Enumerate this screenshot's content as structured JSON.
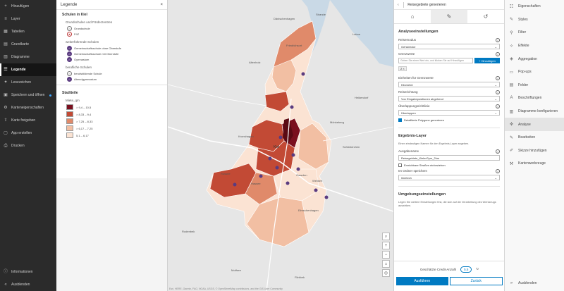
{
  "leftnav": {
    "items": [
      {
        "label": "Hinzufügen",
        "icon": "plus-icon"
      },
      {
        "label": "Layer",
        "icon": "layers-icon"
      },
      {
        "label": "Tabellen",
        "icon": "table-icon"
      },
      {
        "label": "Grundkarte",
        "icon": "basemap-icon"
      },
      {
        "label": "Diagramme",
        "icon": "chart-icon"
      },
      {
        "label": "Legende",
        "icon": "legend-icon"
      },
      {
        "label": "Lesezeichen",
        "icon": "bookmark-icon"
      },
      {
        "label": "Speichern und öffnen",
        "icon": "save-icon"
      },
      {
        "label": "Karteneigenschaften",
        "icon": "map-properties-icon"
      },
      {
        "label": "Karte freigeben",
        "icon": "share-icon"
      },
      {
        "label": "App erstellen",
        "icon": "app-icon"
      },
      {
        "label": "Drucken",
        "icon": "print-icon"
      }
    ],
    "bottom": [
      {
        "label": "Informationen",
        "icon": "info-icon"
      },
      {
        "label": "Ausblenden",
        "icon": "collapse-icon"
      }
    ]
  },
  "legend": {
    "title": "Legende",
    "layer1": {
      "title": "Schulen in Kiel",
      "groups": [
        {
          "title": "Grundschulen und Förderzentren",
          "items": [
            "Grundschule",
            "FöZ"
          ]
        },
        {
          "title": "weiterführende Schulen",
          "items": [
            "Gemeinschaftsschule ohne Oberstufe",
            "Gemeinschaftsschule mit Oberstufe",
            "Gymnasium"
          ]
        },
        {
          "title": "berufliche Schulen",
          "items": [
            "berufsbildende Schule",
            "Abendgymnasium"
          ]
        }
      ]
    },
    "layer2": {
      "title": "Stadtteile",
      "field": "Miete_qm",
      "classes": [
        {
          "label": "> 9,4 – 10,5",
          "color": "#7a0f1e"
        },
        {
          "label": "> 8,33 – 9,4",
          "color": "#c24a35"
        },
        {
          "label": "> 7,25 – 8,33",
          "color": "#e08a6a"
        },
        {
          "label": "> 6,17 – 7,25",
          "color": "#f2bfa3"
        },
        {
          "label": "5,1 – 6,17",
          "color": "#fbe3d3"
        }
      ]
    }
  },
  "map": {
    "labels": [
      "Dänischenhagen",
      "Altenholz",
      "Friedrichsort",
      "Strande",
      "Kiel",
      "Heikendorf",
      "Mönkeberg",
      "Schönkirchen",
      "Kronshagen",
      "Russee",
      "Hassee",
      "Gaarden",
      "Elmschenhagen",
      "Wellsee",
      "Rodenbek",
      "Molfsee",
      "Flintbek",
      "Laboe"
    ],
    "attribution": "Esri, HERE, Garmin, FAO, NOAA, USGS, © OpenStreetMap contributors, and the GIS User Community"
  },
  "analysis": {
    "title": "Reisegebiete generieren",
    "section1": "Analyseeinstellungen",
    "reisemodus_label": "Reisemodus",
    "reisemodus_value": "Gehstrecke",
    "grenzwerte_label": "Grenzwerte",
    "grenzwerte_placeholder": "Geben Sie einen Wert ein, und klicken Sie auf Hinzufügen",
    "add_label": "+ Hinzufügen",
    "chip": "2 ×",
    "einheiten_label": "Einheiten für Grenzwerte",
    "einheiten_value": "Kilometer",
    "richtung_label": "Reiserichtung",
    "richtung_value": "Von Eingabepositionen abgehend",
    "ueberlapp_label": "Überlappungsrichtlinie",
    "ueberlapp_value": "Überlappen",
    "detail_label": "Detaillierte Polygone generieren",
    "section2": "Ergebnis-Layer",
    "section2_desc": "Einen eindeutigen Namen für den Ergebnis-Layer angeben.",
    "ausgabe_label": "Ausgabename",
    "ausgabe_value": "Reisegebiete_KielerGym_2km",
    "strassen_label": "Erreichbare Straßen einbeziehen",
    "ordner_label": "Im Ordner speichern",
    "ordner_value": "limetech",
    "section3": "Umgebungseinstellungen",
    "section3_desc": "Legen Sie weitere Einstellungen fest, die sich auf die Verarbeitung des Werkzeugs auswirken.",
    "credits_label": "Geschätzte Credit-Anzahl",
    "credits_value": "5.5",
    "run_label": "Ausführen",
    "back_label": "Zurück"
  },
  "righttools": {
    "items": [
      {
        "label": "Eigenschaften",
        "icon": "properties-icon"
      },
      {
        "label": "Styles",
        "icon": "styles-icon"
      },
      {
        "label": "Filter",
        "icon": "filter-icon"
      },
      {
        "label": "Effekte",
        "icon": "effects-icon"
      },
      {
        "label": "Aggregation",
        "icon": "aggregation-icon"
      },
      {
        "label": "Pop-ups",
        "icon": "popup-icon"
      },
      {
        "label": "Felder",
        "icon": "fields-icon"
      },
      {
        "label": "Beschriftungen",
        "icon": "labels-icon"
      },
      {
        "label": "Diagramme konfigurieren",
        "icon": "chart-config-icon"
      },
      {
        "label": "Analyse",
        "icon": "analysis-icon"
      },
      {
        "label": "Bearbeiten",
        "icon": "edit-icon"
      },
      {
        "label": "Skizze hinzufügen",
        "icon": "sketch-icon"
      },
      {
        "label": "Kartenwerkzeuge",
        "icon": "map-tools-icon"
      }
    ],
    "bottom": "Ausblenden"
  }
}
